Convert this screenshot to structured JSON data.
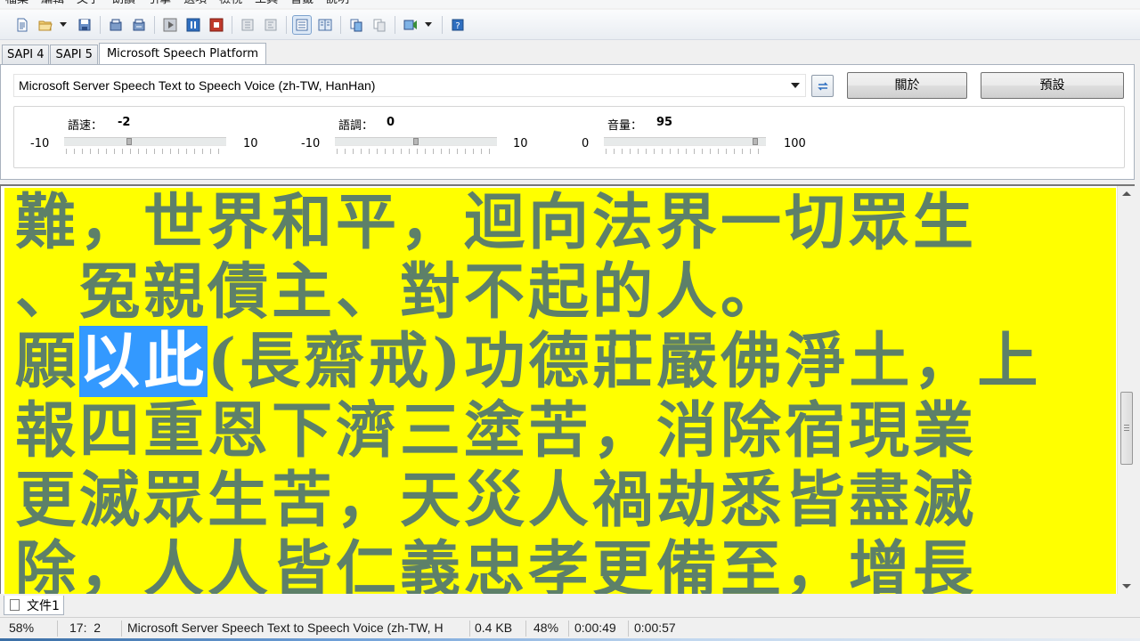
{
  "menu": [
    "檔案",
    "編輯",
    "文字",
    "朗讀",
    "引擎",
    "選項",
    "檢視",
    "工具",
    "書籤",
    "說明"
  ],
  "toolbar": {
    "icons": [
      "new-document-icon",
      "open-folder-icon",
      "save-icon",
      "read-aloud-icon",
      "read-selection-icon",
      "play-icon",
      "pause-icon",
      "stop-icon",
      "previous-icon",
      "next-icon",
      "text-view-icon",
      "columns-icon",
      "convert-icon",
      "convert-batch-icon",
      "output-icon",
      "help-icon"
    ]
  },
  "tabs": [
    "SAPI 4",
    "SAPI 5",
    "Microsoft Speech Platform"
  ],
  "voice": {
    "selected": "Microsoft Server Speech Text to Speech Voice (zh-TW, HanHan)"
  },
  "buttons": {
    "about": "關於",
    "default": "預設"
  },
  "sliders": {
    "rate": {
      "label": "語速：",
      "value": "-2",
      "min": "-10",
      "max": "10",
      "level": 0.4
    },
    "pitch": {
      "label": "語調：",
      "value": "0",
      "min": "-10",
      "max": "10",
      "level": 0.5
    },
    "volume": {
      "label": "音量：",
      "value": "95",
      "min": "0",
      "max": "100",
      "level": 0.95
    }
  },
  "document": {
    "lines": [
      {
        "before": "難，世界和平，迴向法界一切眾生",
        "highlight": "",
        "after": ""
      },
      {
        "before": "、冤親債主、對不起的人。",
        "highlight": "",
        "after": ""
      },
      {
        "before": "願",
        "highlight": "以此",
        "after": "(長齋戒)功德莊嚴佛淨土，上"
      },
      {
        "before": "報四重恩下濟三塗苦，消除宿現業",
        "highlight": "",
        "after": ""
      },
      {
        "before": "更滅眾生苦，天災人禍劫悉皆盡滅",
        "highlight": "",
        "after": ""
      },
      {
        "before": "除，人人皆仁義忠孝更備至，增長",
        "highlight": "",
        "after": ""
      }
    ]
  },
  "doc_tab": "文件1",
  "status": {
    "zoom": "58%",
    "position": "17:  2",
    "voice": "Microsoft Server Speech Text to Speech Voice (zh-TW, H",
    "size": "0.4 KB",
    "progress": "48%",
    "elapsed": "0:00:49",
    "total": "0:00:57"
  }
}
